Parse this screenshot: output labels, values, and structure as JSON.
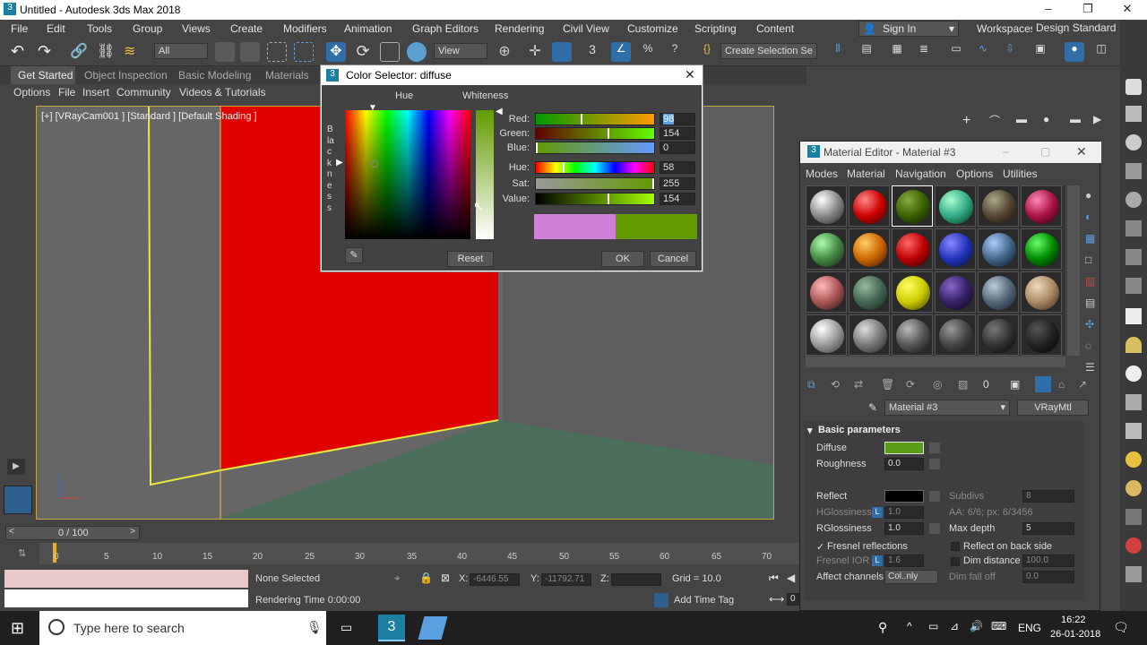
{
  "window": {
    "title": "Untitled - Autodesk 3ds Max 2018"
  },
  "menu": [
    "File",
    "Edit",
    "Tools",
    "Group",
    "Views",
    "Create",
    "Modifiers",
    "Animation",
    "Graph Editors",
    "Rendering",
    "Civil View",
    "Customize",
    "Scripting",
    "Content"
  ],
  "signin": "Sign In",
  "workspaces": {
    "label": "Workspaces:",
    "value": "Design Standard"
  },
  "toolbar": {
    "filter": "All",
    "view": "View",
    "selection_set": "Create Selection Se"
  },
  "ribbon_tabs": [
    "Get Started",
    "Object Inspection",
    "Basic Modeling",
    "Materials"
  ],
  "sub_tabs": [
    "Options",
    "File",
    "Insert",
    "Community",
    "Videos & Tutorials"
  ],
  "viewport": {
    "label": "[+] [VRayCam001 ] [Standard ] [Default Shading ]"
  },
  "colors": {
    "accent": "#5a9e18",
    "viewport_bg": "#666666",
    "red_wall": "#e00000",
    "selected_outline": "#e8e840"
  },
  "color_selector": {
    "title": "Color Selector: diffuse",
    "hue_label": "Hue",
    "whiteness_label": "Whiteness",
    "blackness_label": "Blackness",
    "channels": [
      {
        "label": "Red:",
        "value": "98"
      },
      {
        "label": "Green:",
        "value": "154"
      },
      {
        "label": "Blue:",
        "value": "0"
      },
      {
        "label": "Hue:",
        "value": "58"
      },
      {
        "label": "Sat:",
        "value": "255"
      },
      {
        "label": "Value:",
        "value": "154"
      }
    ],
    "old_color": "#d080d8",
    "new_color": "#629a00",
    "reset": "Reset",
    "ok": "OK",
    "cancel": "Cancel"
  },
  "material_editor": {
    "title": "Material Editor - Material #3",
    "menus": [
      "Modes",
      "Material",
      "Navigation",
      "Options",
      "Utilities"
    ],
    "material_name": "Material #3",
    "material_type": "VRayMtl",
    "rollout": "Basic parameters",
    "params": {
      "diffuse": "Diffuse",
      "roughness": "Roughness",
      "roughness_val": "0.0",
      "reflect": "Reflect",
      "subdivs": "Subdivs",
      "subdivs_val": "8",
      "hglossiness": "HGlossiness",
      "hgloss_val": "1.0",
      "aa": "AA: 6/6; px: 6/3456",
      "rglossiness": "RGlossiness",
      "rgloss_val": "1.0",
      "max_depth": "Max depth",
      "max_depth_val": "5",
      "fresnel": "Fresnel reflections",
      "reflect_back": "Reflect on back side",
      "fresnel_ior": "Fresnel IOR",
      "fresnel_ior_val": "1.6",
      "dim_distance": "Dim distance",
      "dim_distance_val": "100.0",
      "affect": "Affect channels",
      "affect_val": "Col..nly",
      "dim_falloff": "Dim fall off",
      "dim_falloff_val": "0.0"
    }
  },
  "timeline": {
    "frame": "0 / 100",
    "ticks": [
      "0",
      "5",
      "10",
      "15",
      "20",
      "25",
      "30",
      "35",
      "40",
      "45",
      "50",
      "55",
      "60",
      "65",
      "70"
    ]
  },
  "status": {
    "selection": "None Selected",
    "render_time": "Rendering Time 0:00:00",
    "x": "-6446.55",
    "y": "-11792.71",
    "z": "",
    "grid": "Grid = 10.0",
    "add_time_tag": "Add Time Tag",
    "time_field": "0"
  },
  "taskbar": {
    "search": "Type here to search",
    "lang": "ENG",
    "time": "16:22",
    "date": "26-01-2018"
  }
}
